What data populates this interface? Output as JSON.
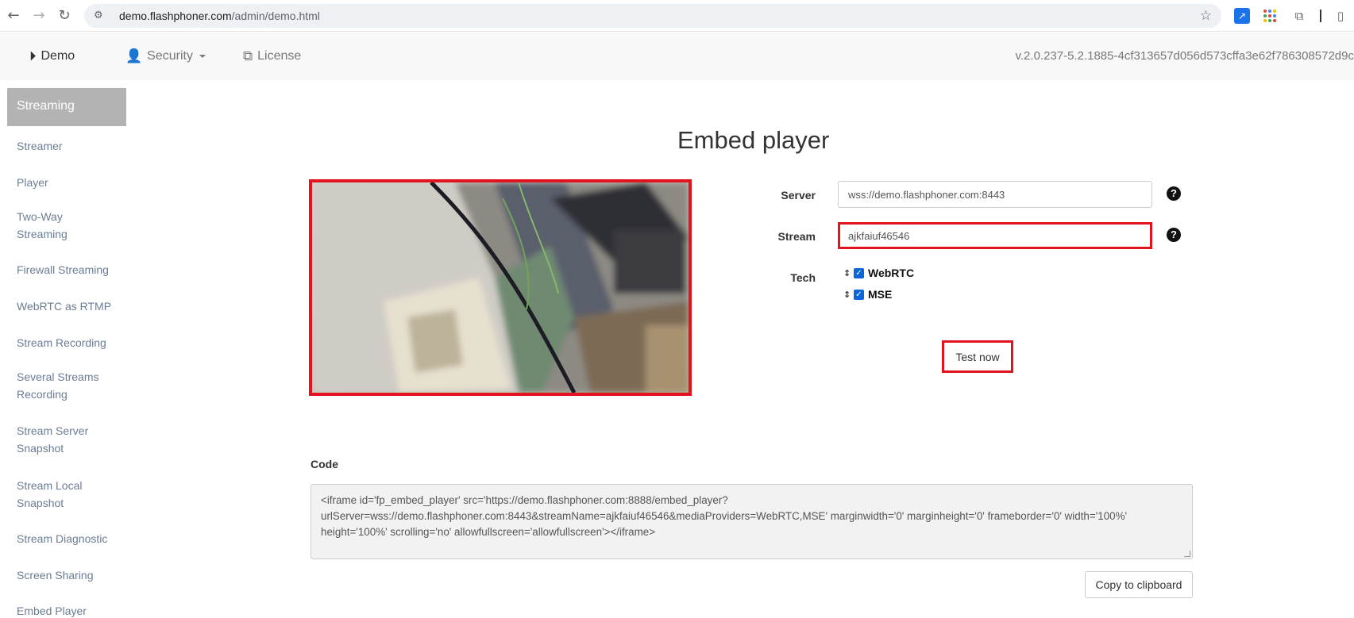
{
  "browser": {
    "url_domain": "demo.flashphoner.com",
    "url_path": "/admin/demo.html"
  },
  "header": {
    "nav": [
      {
        "label": "Demo",
        "icon": "play-circle-icon"
      },
      {
        "label": "Security",
        "icon": "user-secret-icon"
      },
      {
        "label": "License",
        "icon": "copy-icon"
      }
    ],
    "version": "v.2.0.237-5.2.1885-4cf313657d056d573cffa3e62f786308572d9c"
  },
  "sidebar": {
    "heading": "Streaming",
    "items": [
      {
        "label": "Streamer"
      },
      {
        "label": "Player"
      },
      {
        "label": "Two-Way Streaming"
      },
      {
        "label": "Firewall Streaming"
      },
      {
        "label": "WebRTC as RTMP"
      },
      {
        "label": "Stream Recording"
      },
      {
        "label": "Several Streams Recording"
      },
      {
        "label": "Stream Server Snapshot"
      },
      {
        "label": "Stream Local Snapshot"
      },
      {
        "label": "Stream Diagnostic"
      },
      {
        "label": "Screen Sharing"
      },
      {
        "label": "Embed Player"
      }
    ]
  },
  "main": {
    "title": "Embed player",
    "server_label": "Server",
    "server_value": "wss://demo.flashphoner.com:8443",
    "stream_label": "Stream",
    "stream_value": "ajkfaiuf46546",
    "tech_label": "Tech",
    "tech_options": [
      {
        "label": "WebRTC",
        "checked": true
      },
      {
        "label": "MSE",
        "checked": true
      }
    ],
    "test_button": "Test now",
    "code_label": "Code",
    "code_line1": "<iframe id='fp_embed_player' src='https://demo.flashphoner.com:8888/embed_player?",
    "code_line2": "urlServer=wss://demo.flashphoner.com:8443&streamName=ajkfaiuf46546&mediaProviders=WebRTC,MSE' marginwidth='0' marginheight='0' frameborder='0' width='100%'",
    "code_line3": "height='100%' scrolling='no' allowfullscreen='allowfullscreen'></iframe>",
    "copy_button": "Copy to clipboard"
  },
  "colors": {
    "highlight_red": "#e0131f",
    "sidebar_active_bg": "#b3b3b3",
    "sidebar_link": "#6b7d92",
    "checkbox_blue": "#0b66d8"
  }
}
